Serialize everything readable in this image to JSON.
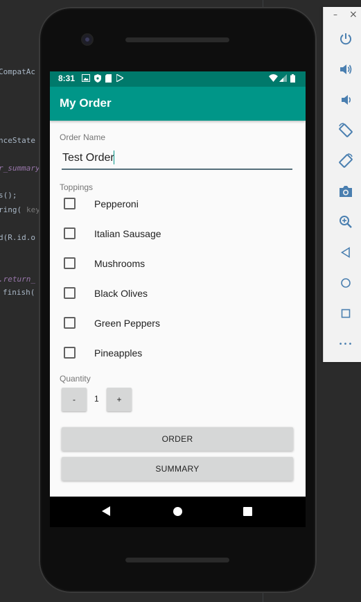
{
  "ide": {
    "code_lines": [
      {
        "text": "CompatAc",
        "style": "normal"
      },
      {
        "text": "nceState",
        "style": "normal"
      },
      {
        "text": "r_summary",
        "style": "italic"
      },
      {
        "text": "s();",
        "style": "normal"
      },
      {
        "text": "ring(",
        "style": "normal"
      },
      {
        "text": "key",
        "style": "hint"
      },
      {
        "text": "d(R.id.o",
        "style": "normal"
      },
      {
        "text": ".return_",
        "style": "italic"
      },
      {
        "text": "finish(",
        "style": "normal"
      }
    ]
  },
  "status_bar": {
    "time": "8:31"
  },
  "app_bar": {
    "title": "My Order"
  },
  "order_name": {
    "label": "Order Name",
    "value": "Test Order"
  },
  "toppings": {
    "label": "Toppings",
    "items": [
      {
        "label": "Pepperoni",
        "checked": false
      },
      {
        "label": "Italian Sausage",
        "checked": false
      },
      {
        "label": "Mushrooms",
        "checked": false
      },
      {
        "label": "Black Olives",
        "checked": false
      },
      {
        "label": "Green Peppers",
        "checked": false
      },
      {
        "label": "Pineapples",
        "checked": false
      }
    ]
  },
  "quantity": {
    "label": "Quantity",
    "decrement_label": "-",
    "value": "1",
    "increment_label": "+"
  },
  "buttons": {
    "order_label": "ORDER",
    "summary_label": "SUMMARY"
  },
  "emulator_toolbar": {
    "minimize": "–",
    "close": "×",
    "more": "•••",
    "icons": [
      "power-icon",
      "volume-up-icon",
      "volume-down-icon",
      "rotate-left-icon",
      "rotate-right-icon",
      "camera-icon",
      "zoom-icon",
      "back-icon",
      "home-icon",
      "overview-icon",
      "more-icon"
    ]
  },
  "colors": {
    "primary": "#009688",
    "primary_dark": "#00796b"
  }
}
